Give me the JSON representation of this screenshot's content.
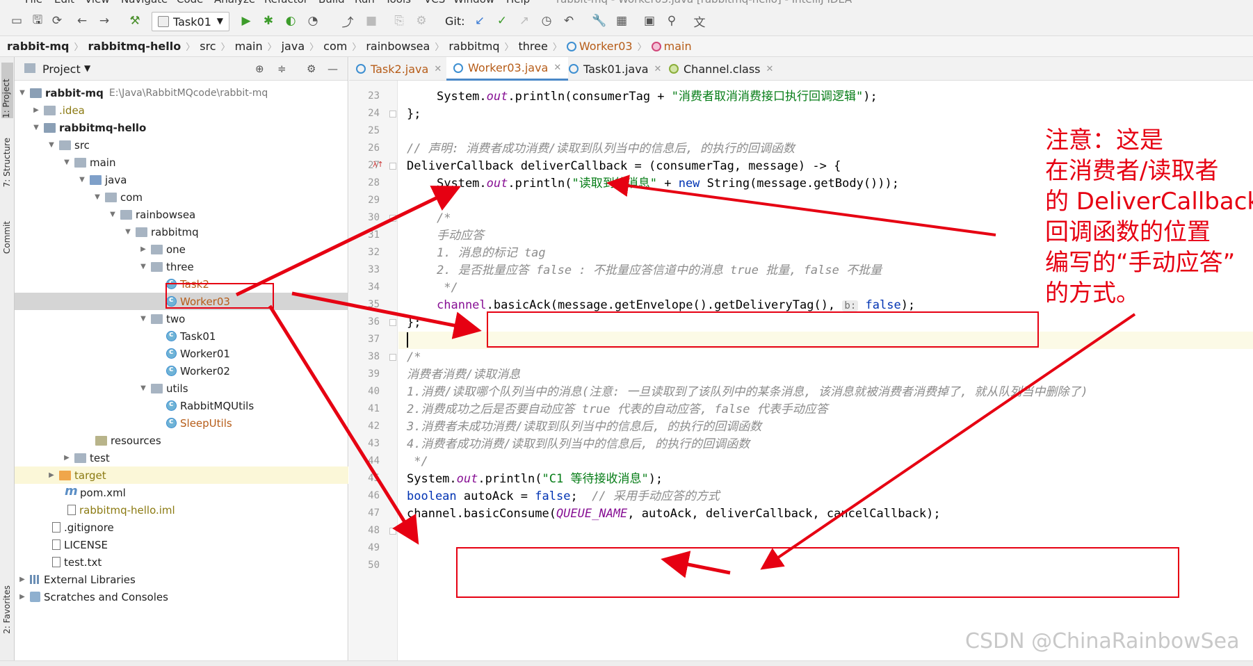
{
  "menu": [
    "File",
    "Edit",
    "View",
    "Navigate",
    "Code",
    "Analyze",
    "Refactor",
    "Build",
    "Run",
    "Tools",
    "VCS",
    "Window",
    "Help"
  ],
  "window_title": "rabbit-mq - Worker03.java [rabbitmq-hello] - IntelliJ IDEA",
  "toolbar": {
    "run_config": "Task01",
    "git_label": "Git:"
  },
  "breadcrumb": [
    "rabbit-mq",
    "rabbitmq-hello",
    "src",
    "main",
    "java",
    "com",
    "rainbowsea",
    "rabbitmq",
    "three",
    "Worker03",
    "main"
  ],
  "toolstrip": {
    "project": "1: Project",
    "structure": "7: Structure",
    "commit": "Commit",
    "favorites": "2: Favorites"
  },
  "project_panel": {
    "title": "Project",
    "tree": [
      {
        "label": "rabbit-mq",
        "path": "E:\\Java\\RabbitMQcode\\rabbit-mq"
      },
      {
        "label": ".idea"
      },
      {
        "label": "rabbitmq-hello"
      },
      {
        "label": "src"
      },
      {
        "label": "main"
      },
      {
        "label": "java"
      },
      {
        "label": "com"
      },
      {
        "label": "rainbowsea"
      },
      {
        "label": "rabbitmq"
      },
      {
        "label": "one"
      },
      {
        "label": "three"
      },
      {
        "label": "Task2"
      },
      {
        "label": "Worker03"
      },
      {
        "label": "two"
      },
      {
        "label": "Task01"
      },
      {
        "label": "Worker01"
      },
      {
        "label": "Worker02"
      },
      {
        "label": "utils"
      },
      {
        "label": "RabbitMQUtils"
      },
      {
        "label": "SleepUtils"
      },
      {
        "label": "resources"
      },
      {
        "label": "test"
      },
      {
        "label": "target"
      },
      {
        "label": "pom.xml"
      },
      {
        "label": "rabbitmq-hello.iml"
      },
      {
        "label": ".gitignore"
      },
      {
        "label": "LICENSE"
      },
      {
        "label": "test.txt"
      },
      {
        "label": "External Libraries"
      },
      {
        "label": "Scratches and Consoles"
      }
    ]
  },
  "tabs": [
    "Task2.java",
    "Worker03.java",
    "Task01.java",
    "Channel.class"
  ],
  "line_numbers": [
    "23",
    "24",
    "25",
    "26",
    "27",
    "28",
    "29",
    "30",
    "31",
    "32",
    "33",
    "34",
    "35",
    "36",
    "37",
    "38",
    "39",
    "40",
    "41",
    "42",
    "43",
    "44",
    "45",
    "46",
    "47",
    "48",
    "49",
    "50"
  ],
  "code": {
    "l23a": "System.",
    "l23b": "out",
    "l23c": ".println(consumerTag + ",
    "l23d": "\"消费者取消消费接口执行回调逻辑\"",
    "l23e": ");",
    "l24": "};",
    "l26": "// 声明: 消费者成功消费/读取到队列当中的信息后, 的执行的回调函数",
    "l27": "DeliverCallback deliverCallback = (consumerTag, message) -> {",
    "l28a": "System.",
    "l28b": "out",
    "l28c": ".println(",
    "l28d": "\"读取到的消息\"",
    "l28e": " + ",
    "l28f": "new",
    "l28g": " String(message.getBody()));",
    "l30": "/*",
    "l31": "手动应答",
    "l32": "1. 消息的标记 tag",
    "l33": "2. 是否批量应答 false : 不批量应答信道中的消息 true 批量, false 不批量",
    "l34": " */",
    "l35a": "channel",
    "l35b": ".basicAck(message.getEnvelope().getDeliveryTag(), ",
    "l35c": "b:",
    "l35d": " false",
    "l35e": ");",
    "l36": "};",
    "l38": "/*",
    "l39": "消费者消费/读取消息",
    "l40": "1.消费/读取哪个队列当中的消息(注意: 一旦读取到了该队列中的某条消息, 该消息就被消费者消费掉了, 就从队列当中删除了)",
    "l41": "2.消费成功之后是否要自动应答 true 代表的自动应答, false 代表手动应答",
    "l42": "3.消费者未成功消费/读取到队列当中的信息后, 的执行的回调函数",
    "l43": "4.消费者成功消费/读取到队列当中的信息后, 的执行的回调函数",
    "l44": " */",
    "l45a": "System.",
    "l45b": "out",
    "l45c": ".println(",
    "l45d": "\"C1 等待接收消息\"",
    "l45e": ");",
    "l46a": "boolean",
    "l46b": " autoAck = ",
    "l46c": "false",
    "l46d": ";  ",
    "l46e": "// 采用手动应答的方式",
    "l47a": "channel.basicConsume(",
    "l47b": "QUEUE_NAME",
    "l47c": ", autoAck, deliverCallback, cancelCallback);",
    "l48": "}",
    "l49": "}"
  },
  "annotation": {
    "lines": [
      "注意：这是",
      "在消费者/读取者",
      "的 DeliverCallback",
      "回调函数的位置",
      "编写的“手动应答”",
      "的方式。"
    ],
    "color": "#e60012"
  },
  "watermark": "CSDN @ChinaRainbowSea"
}
